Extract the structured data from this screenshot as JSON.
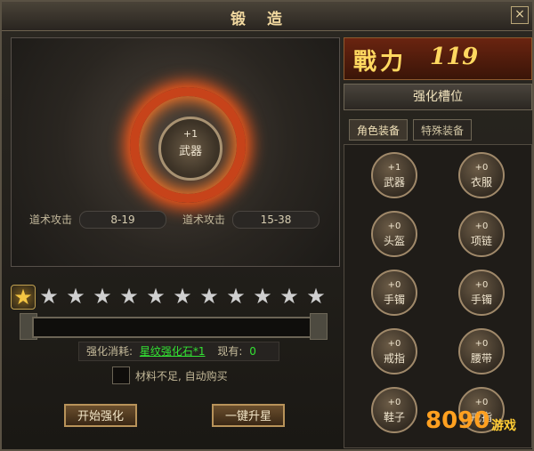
{
  "window": {
    "title": "锻造",
    "close_icon": "×"
  },
  "preview": {
    "item": {
      "level": "+1",
      "name": "武器"
    },
    "stats": [
      {
        "label": "道术攻击",
        "value": "8-19"
      },
      {
        "label": "道术攻击",
        "value": "15-38"
      }
    ]
  },
  "stars": {
    "total": 12,
    "active": 1
  },
  "progress": {
    "fill_fraction": 0.0
  },
  "cost": {
    "label": "强化消耗:",
    "item": "星纹强化石*1",
    "owned_label": "现有:",
    "owned_value": "0",
    "item_color": "#33e233"
  },
  "auto_buy": {
    "label": "材料不足, 自动购买",
    "checked": false
  },
  "buttons": {
    "start": "开始强化",
    "onekey": "一键升星"
  },
  "power": {
    "label": "戰力",
    "value": "119"
  },
  "slots_panel": {
    "title": "强化槽位",
    "tabs": [
      {
        "label": "角色装备",
        "active": true
      },
      {
        "label": "特殊装备",
        "active": false
      }
    ],
    "slots": [
      {
        "level": "+1",
        "name": "武器"
      },
      {
        "level": "+0",
        "name": "衣服"
      },
      {
        "level": "+0",
        "name": "头盔"
      },
      {
        "level": "+0",
        "name": "项链"
      },
      {
        "level": "+0",
        "name": "手镯"
      },
      {
        "level": "+0",
        "name": "手镯"
      },
      {
        "level": "+0",
        "name": "戒指"
      },
      {
        "level": "+0",
        "name": "腰带"
      },
      {
        "level": "+0",
        "name": "鞋子"
      },
      {
        "level": "+0",
        "name": "戒指"
      }
    ]
  },
  "watermark": {
    "text": "8090",
    "cn": "游戏"
  },
  "colors": {
    "accent": "#f5c643",
    "frame": "#6e6655"
  }
}
